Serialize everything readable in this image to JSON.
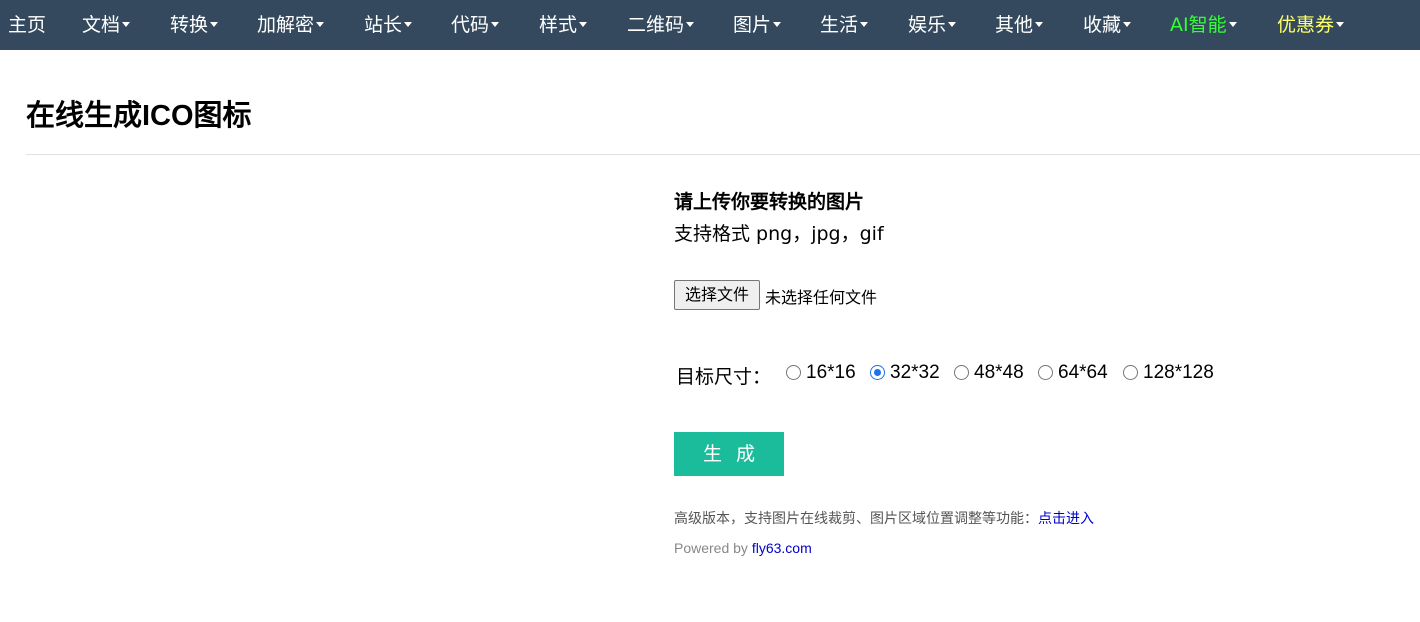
{
  "nav": {
    "items": [
      {
        "label": "主页",
        "dropdown": false,
        "color": "#ffffff"
      },
      {
        "label": "文档",
        "dropdown": true,
        "color": "#ffffff"
      },
      {
        "label": "转换",
        "dropdown": true,
        "color": "#ffffff"
      },
      {
        "label": "加解密",
        "dropdown": true,
        "color": "#ffffff"
      },
      {
        "label": "站长",
        "dropdown": true,
        "color": "#ffffff"
      },
      {
        "label": "代码",
        "dropdown": true,
        "color": "#ffffff"
      },
      {
        "label": "样式",
        "dropdown": true,
        "color": "#ffffff"
      },
      {
        "label": "二维码",
        "dropdown": true,
        "color": "#ffffff"
      },
      {
        "label": "图片",
        "dropdown": true,
        "color": "#ffffff"
      },
      {
        "label": "生活",
        "dropdown": true,
        "color": "#ffffff"
      },
      {
        "label": "娱乐",
        "dropdown": true,
        "color": "#ffffff"
      },
      {
        "label": "其他",
        "dropdown": true,
        "color": "#ffffff"
      },
      {
        "label": "收藏",
        "dropdown": true,
        "color": "#ffffff"
      },
      {
        "label": "AI智能",
        "dropdown": true,
        "color": "#33ff33"
      },
      {
        "label": "优惠券",
        "dropdown": true,
        "color": "#ffff66"
      }
    ],
    "background": "#34495e"
  },
  "page": {
    "title": "在线生成ICO图标"
  },
  "upload": {
    "heading": "请上传你要转换的图片",
    "formats": "支持格式 png，jpg，gif",
    "choose_file_label": "选择文件",
    "file_status": "未选择任何文件"
  },
  "size": {
    "label": "目标尺寸：",
    "options": [
      {
        "label": "16*16",
        "checked": false
      },
      {
        "label": "32*32",
        "checked": true
      },
      {
        "label": "48*48",
        "checked": false
      },
      {
        "label": "64*64",
        "checked": false
      },
      {
        "label": "128*128",
        "checked": false
      }
    ]
  },
  "actions": {
    "generate_label": "生成",
    "accent_color": "#1abc9c"
  },
  "footer": {
    "advanced_text": "高级版本，支持图片在线裁剪、图片区域位置调整等功能：",
    "advanced_link": "点击进入",
    "powered_prefix": "Powered by ",
    "powered_link": "fly63.com"
  }
}
